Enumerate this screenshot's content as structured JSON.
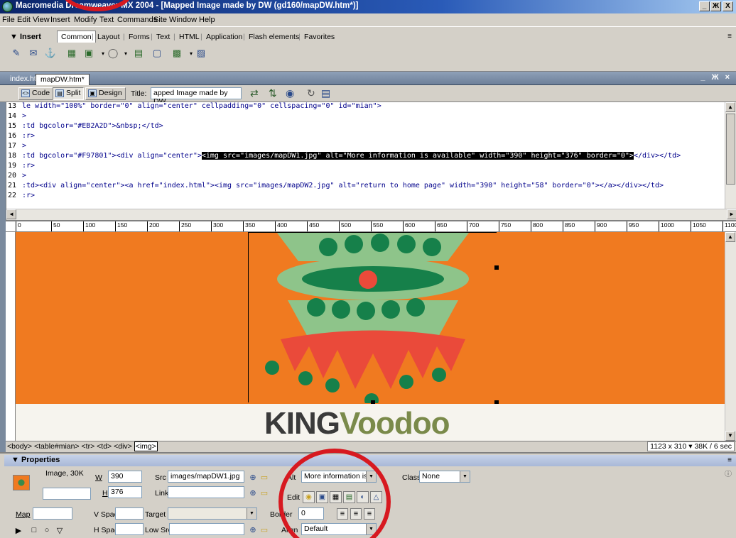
{
  "window": {
    "title": "Macromedia Dreamweaver MX 2004 - [Mapped Image made by DW (gd160/mapDW.htm*)]",
    "controls": [
      "_",
      "Ж",
      "X"
    ]
  },
  "menu": [
    "File",
    "Edit",
    "View",
    "Insert",
    "Modify",
    "Text",
    "Commands",
    "Site",
    "Window",
    "Help"
  ],
  "insert_bar": {
    "title": "▼ Insert",
    "tabs": [
      "Common",
      "Layout",
      "Forms",
      "Text",
      "HTML",
      "Application",
      "Flash elements",
      "Favorites"
    ]
  },
  "doc_tabs": [
    "index.html*",
    "mapDW.htm*"
  ],
  "doc_controls": "_ Ж ×",
  "doc_toolbar": {
    "code_label": "Code",
    "split_label": "Split",
    "design_label": "Design",
    "title_label": "Title:",
    "title_value": "apped Image made by DW"
  },
  "code_lines": [
    {
      "num": "13",
      "text": "le width=\"100%\" border=\"0\" align=\"center\" cellpadding=\"0\" cellspacing=\"0\" id=\"mian\">"
    },
    {
      "num": "14",
      "text": ">"
    },
    {
      "num": "15",
      "text": ":td bgcolor=\"#EB2A2D\">&nbsp;</td>"
    },
    {
      "num": "16",
      "text": ":r>"
    },
    {
      "num": "17",
      "text": ">"
    },
    {
      "num": "18",
      "pre": ":td bgcolor=\"#F97801\"><div align=\"center\">",
      "hl": "<img src=\"images/mapDW1.jpg\" alt=\"More information is available\" width=\"390\" height=\"376\" border=\"0\">",
      "post": "</div></td>"
    },
    {
      "num": "19",
      "text": ":r>"
    },
    {
      "num": "20",
      "text": ">"
    },
    {
      "num": "21",
      "text": ":td><div align=\"center\"><a href=\"index.html\"><img src=\"images/mapDW2.jpg\" alt=\"return to home page\" width=\"390\" height=\"58\" border=\"0\"></a></div></td>"
    },
    {
      "num": "22",
      "text": ":r>"
    }
  ],
  "ruler_ticks": [
    "0",
    "50",
    "100",
    "150",
    "200",
    "250",
    "300",
    "350",
    "400",
    "450",
    "500",
    "550",
    "600",
    "650",
    "700",
    "750",
    "800",
    "850",
    "900",
    "950",
    "1000",
    "1050",
    "1100"
  ],
  "design": {
    "logo_part1": "KING",
    "logo_part2": "Voodoo",
    "bg_color": "#f07a20"
  },
  "status": {
    "tags": [
      "<body>",
      "<table#mian>",
      "<tr>",
      "<td>",
      "<div>"
    ],
    "selected_tag": "<img>",
    "doc_size": "1123 x 310 ▾ 38K / 6 sec"
  },
  "properties": {
    "title": "▼ Properties",
    "image_label": "Image, 30K",
    "w_label": "W",
    "w_value": "390",
    "h_label": "H",
    "h_value": "376",
    "src_label": "Src",
    "src_value": "images/mapDW1.jpg",
    "link_label": "Link",
    "link_value": "",
    "alt_label": "Alt",
    "alt_value": "More information is",
    "edit_label": "Edit",
    "class_label": "Class",
    "class_value": "None",
    "map_label": "Map",
    "vspace_label": "V Space",
    "hspace_label": "H Space",
    "target_label": "Target",
    "lowsrc_label": "Low Src",
    "border_label": "Border",
    "border_value": "0",
    "align_label": "Align",
    "align_value": "Default"
  }
}
